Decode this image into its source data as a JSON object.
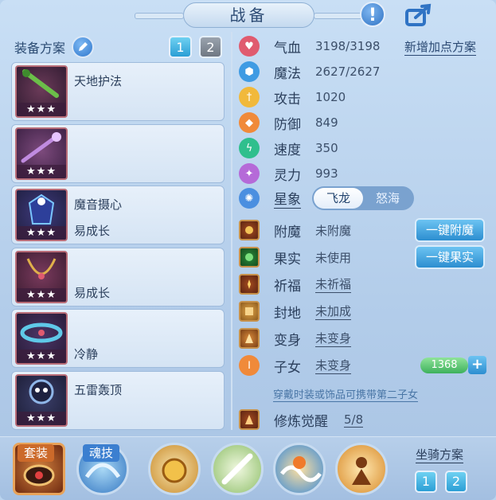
{
  "header": {
    "title": "战备"
  },
  "left": {
    "label": "装备方案",
    "plan_buttons": [
      "1",
      "2"
    ],
    "slots": [
      {
        "name_top": "天地护法",
        "name_bottom": "",
        "stars": "★★★"
      },
      {
        "name_top": "",
        "name_bottom": "",
        "stars": "★★★"
      },
      {
        "name_top": "魔音摄心",
        "name_bottom": "易成长",
        "stars": "★★★"
      },
      {
        "name_top": "",
        "name_bottom": "易成长",
        "stars": "★★★"
      },
      {
        "name_top": "",
        "name_bottom": "冷静",
        "stars": "★★★"
      },
      {
        "name_top": "五雷轰顶",
        "name_bottom": "",
        "stars": "★★★"
      }
    ]
  },
  "stats": {
    "add_plan": "新增加点方案",
    "rows": [
      {
        "name": "气血",
        "value": "3198/3198",
        "color": "#e05b6f",
        "icon": "heart-icon"
      },
      {
        "name": "魔法",
        "value": "2627/2627",
        "color": "#3f9be3",
        "icon": "hexagon-icon"
      },
      {
        "name": "攻击",
        "value": "1020",
        "color": "#f1b93b",
        "icon": "sword-icon"
      },
      {
        "name": "防御",
        "value": "849",
        "color": "#f08a3a",
        "icon": "shield-icon"
      },
      {
        "name": "速度",
        "value": "350",
        "color": "#2fbf8d",
        "icon": "lightning-icon"
      },
      {
        "name": "灵力",
        "value": "993",
        "color": "#b56ad8",
        "icon": "spirit-icon"
      }
    ]
  },
  "xingxiang": {
    "label": "星象",
    "options": [
      "飞龙",
      "怒海"
    ]
  },
  "extras": {
    "rows": [
      {
        "name": "附魔",
        "value": "未附魔",
        "link": false
      },
      {
        "name": "果实",
        "value": "未使用",
        "link": false
      },
      {
        "name": "祈福",
        "value": "未祈福",
        "link": true
      },
      {
        "name": "封地",
        "value": "未加成",
        "link": true
      },
      {
        "name": "变身",
        "value": "未变身",
        "link": true
      },
      {
        "name": "子女",
        "value": "未变身",
        "link": true
      }
    ],
    "fumo_button": "一键附魔",
    "guoshi_button": "一键果实",
    "count": "1368",
    "plus": "+",
    "hint": "穿戴时装或饰品可携带第二子女",
    "xiulian_label": "修炼觉醒",
    "xiulian_value": "5/8"
  },
  "bottom": {
    "tag_taozhuang": "套装",
    "tag_hunji": "魂技",
    "mount_label": "坐骑方案",
    "mount_buttons": [
      "1",
      "2"
    ]
  }
}
